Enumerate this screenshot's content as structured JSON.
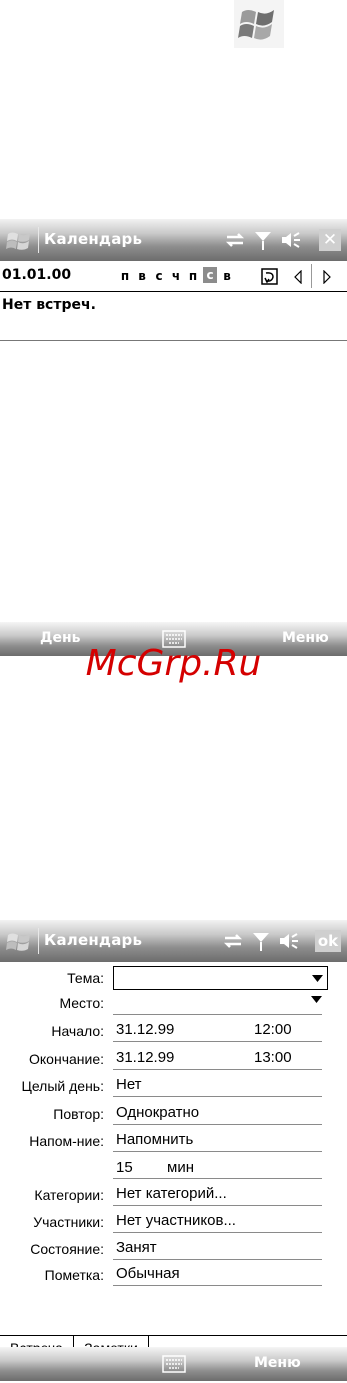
{
  "screen1": {
    "title": "Календарь",
    "date": "01.01.00",
    "weekdays": [
      "п",
      "в",
      "с",
      "ч",
      "п",
      "с",
      "в"
    ],
    "selected_weekday_index": 5,
    "no_appointments": "Нет встреч.",
    "softkey_left": "День",
    "softkey_right": "Меню"
  },
  "watermark": "McGrp.Ru",
  "screen2": {
    "title": "Календарь",
    "ok_label": "ok",
    "fields": [
      {
        "label": "Тема:",
        "value": ""
      },
      {
        "label": "Место:",
        "value": ""
      },
      {
        "label": "Начало:",
        "value": "31.12.99",
        "value2": "12:00"
      },
      {
        "label": "Окончание:",
        "value": "31.12.99",
        "value2": "13:00"
      },
      {
        "label": "Целый день:",
        "value": "Нет"
      },
      {
        "label": "Повтор:",
        "value": "Однократно"
      },
      {
        "label": "Напом-ние:",
        "value": "Напомнить"
      },
      {
        "label": "",
        "value": "15",
        "value2": "мин"
      },
      {
        "label": "Категории:",
        "value": "Нет категорий..."
      },
      {
        "label": "Участники:",
        "value": "Нет участников..."
      },
      {
        "label": "Состояние:",
        "value": "Занят"
      },
      {
        "label": "Пометка:",
        "value": "Обычная"
      }
    ],
    "tabs": [
      "Встреча",
      "Заметки"
    ],
    "softkey_right": "Меню"
  },
  "icons": [
    "windows-logo-icon",
    "sync-icon",
    "signal-icon",
    "volume-icon",
    "close-icon",
    "calendar-today-icon",
    "arrow-left-icon",
    "arrow-right-icon",
    "keyboard-icon",
    "dropdown-arrow-icon"
  ],
  "colors": {
    "titlebar": "#8e8e8e",
    "watermark": "#d40000",
    "selected_day": "#8c8c8c"
  }
}
